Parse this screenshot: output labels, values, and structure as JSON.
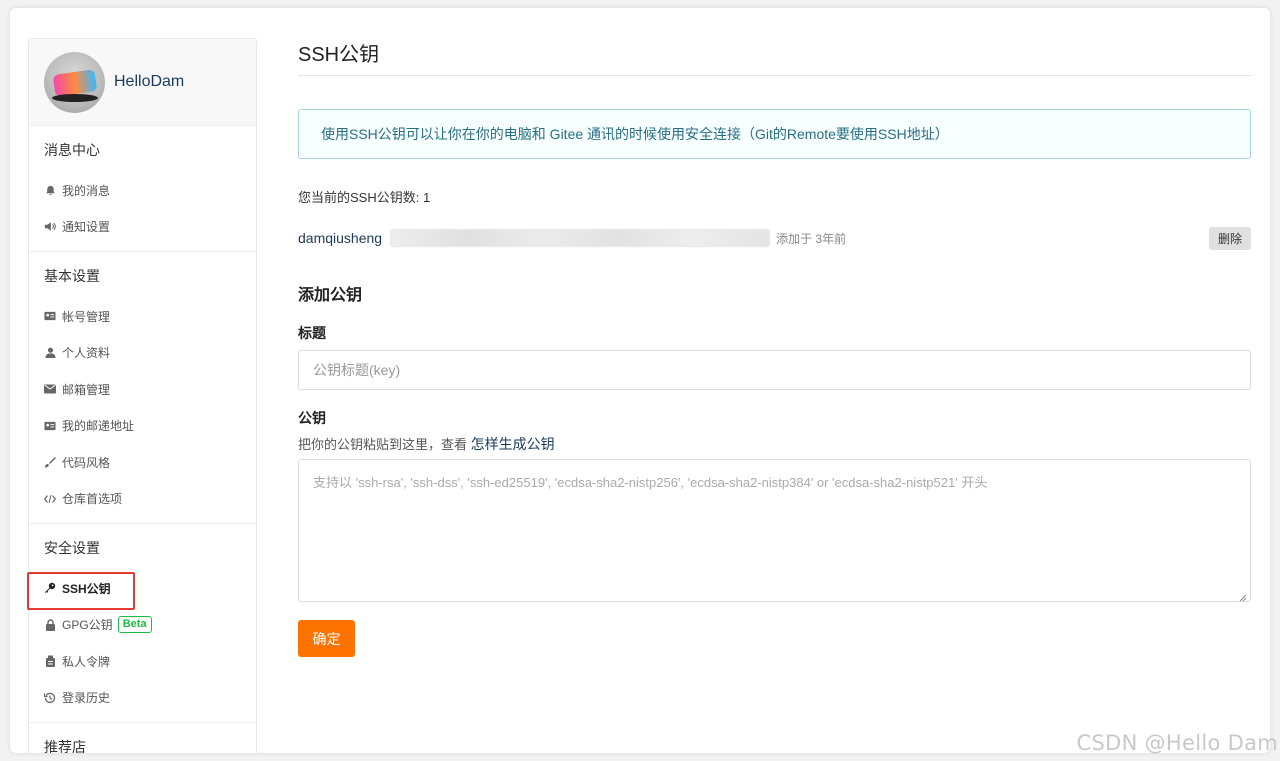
{
  "profile": {
    "name": "HelloDam"
  },
  "sidebar": {
    "sections": [
      {
        "title": "消息中心",
        "items": [
          {
            "label": "我的消息",
            "icon": "bell-icon"
          },
          {
            "label": "通知设置",
            "icon": "volume-icon"
          }
        ]
      },
      {
        "title": "基本设置",
        "items": [
          {
            "label": "帐号管理",
            "icon": "id-card-icon"
          },
          {
            "label": "个人资料",
            "icon": "user-icon"
          },
          {
            "label": "邮箱管理",
            "icon": "envelope-icon"
          },
          {
            "label": "我的邮递地址",
            "icon": "address-card-icon"
          },
          {
            "label": "代码风格",
            "icon": "paint-brush-icon"
          },
          {
            "label": "仓库首选项",
            "icon": "code-icon"
          }
        ]
      },
      {
        "title": "安全设置",
        "items": [
          {
            "label": "SSH公钥",
            "icon": "key-icon",
            "active": true
          },
          {
            "label": "GPG公钥",
            "icon": "lock-icon",
            "badge": "Beta"
          },
          {
            "label": "私人令牌",
            "icon": "token-icon"
          },
          {
            "label": "登录历史",
            "icon": "history-icon"
          }
        ]
      }
    ],
    "partial_section_title": "推荐店"
  },
  "main": {
    "title": "SSH公钥",
    "info": "使用SSH公钥可以让你在你的电脑和 Gitee 通讯的时候使用安全连接（Git的Remote要使用SSH地址）",
    "count_text": "您当前的SSH公钥数: 1",
    "keys": [
      {
        "name": "damqiusheng",
        "added": "添加于 3年前",
        "delete_label": "删除"
      }
    ],
    "add_title": "添加公钥",
    "title_label": "标题",
    "title_placeholder": "公钥标题(key)",
    "key_label": "公钥",
    "key_hint": "把你的公钥粘贴到这里，查看",
    "key_hint_link": "怎样生成公钥",
    "key_placeholder": "支持以 'ssh-rsa', 'ssh-dss', 'ssh-ed25519', 'ecdsa-sha2-nistp256', 'ecdsa-sha2-nistp384' or 'ecdsa-sha2-nistp521' 开头",
    "submit_label": "确定"
  },
  "watermark": "CSDN @Hello Dam",
  "colors": {
    "accent_orange": "#fe7300",
    "info_text": "#276f86",
    "info_border": "#a9d5de",
    "beta_green": "#21ba45",
    "highlight_red": "#e53935"
  }
}
